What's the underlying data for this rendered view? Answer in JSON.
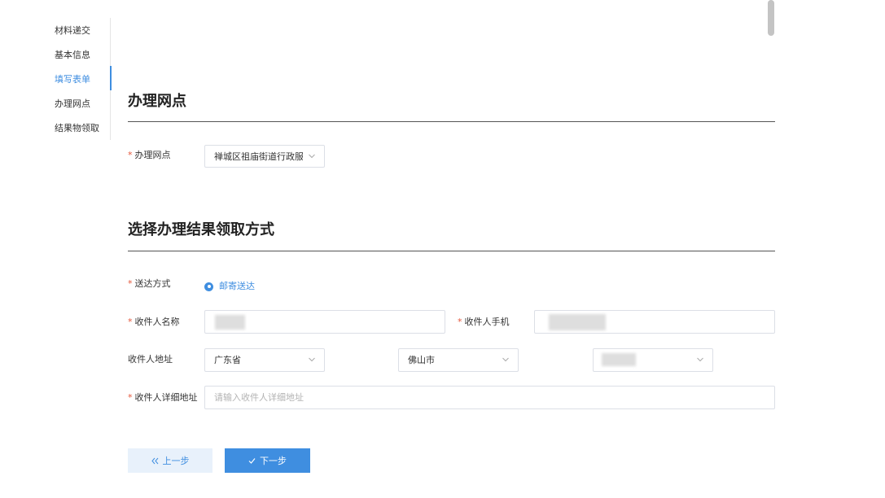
{
  "side_nav": {
    "items": [
      {
        "label": "材料递交"
      },
      {
        "label": "基本信息"
      },
      {
        "label": "填写表单",
        "active": true
      },
      {
        "label": "办理网点"
      },
      {
        "label": "结果物领取"
      }
    ]
  },
  "section_outlet": {
    "title": "办理网点",
    "outlet_label": "办理网点",
    "outlet_value": "禅城区祖庙街道行政服务"
  },
  "section_delivery": {
    "title": "选择办理结果领取方式",
    "method_label": "送达方式",
    "method_option": "邮寄送达",
    "recipient_name_label": "收件人名称",
    "recipient_phone_label": "收件人手机",
    "address_label": "收件人地址",
    "province_value": "广东省",
    "city_value": "佛山市",
    "detail_label": "收件人详细地址",
    "detail_placeholder": "请输入收件人详细地址"
  },
  "buttons": {
    "prev_label": "上一步",
    "next_label": "下一步"
  },
  "colors": {
    "accent": "#3f8ee0",
    "required": "#e5573b"
  },
  "icons": {
    "select_chevron": "chevron-down-icon",
    "prev": "double-chevron-left-icon",
    "next": "checkmark-icon"
  }
}
